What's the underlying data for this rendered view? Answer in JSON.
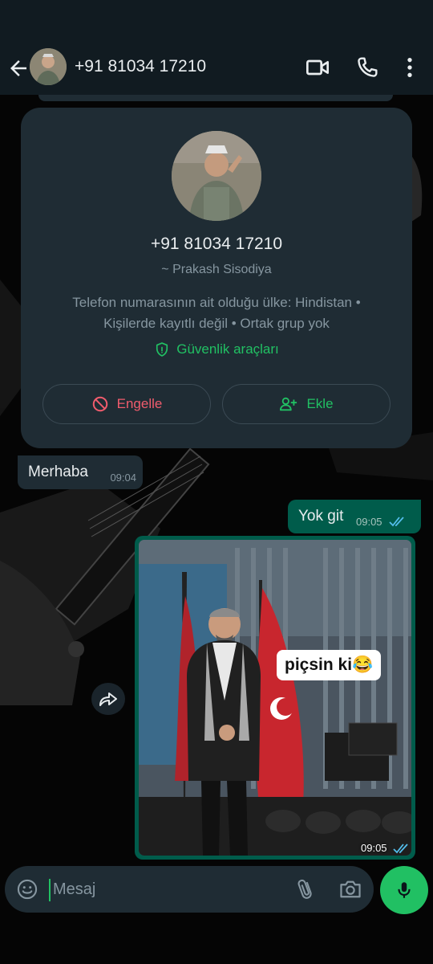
{
  "header": {
    "contact_number": "+91 81034 17210",
    "icons": [
      "back-arrow-icon",
      "video-call-icon",
      "voice-call-icon",
      "more-vert-icon"
    ]
  },
  "contact_card": {
    "phone": "+91 81034 17210",
    "push_name": "~ Prakash Sisodiya",
    "info_line1": "Telefon numarasının ait olduğu ülke: Hindistan •",
    "info_line2": "Kişilerde kayıtlı değil • Ortak grup yok",
    "security_label": "Güvenlik araçları",
    "block_label": "Engelle",
    "add_label": "Ekle"
  },
  "messages": [
    {
      "direction": "incoming",
      "text": "Merhaba",
      "time": "09:04"
    },
    {
      "direction": "outgoing",
      "text": "Yok git",
      "time": "09:05",
      "status": "read"
    },
    {
      "direction": "outgoing",
      "type": "image",
      "caption": "piçsin ki😂",
      "time": "09:05",
      "status": "read"
    }
  ],
  "composer": {
    "placeholder": "Mesaj"
  },
  "colors": {
    "accent": "#21c063",
    "danger": "#f15c6d",
    "outgoing_bubble": "#005c4b",
    "incoming_bubble": "#1f2c34",
    "read_ticks": "#53bdeb"
  }
}
